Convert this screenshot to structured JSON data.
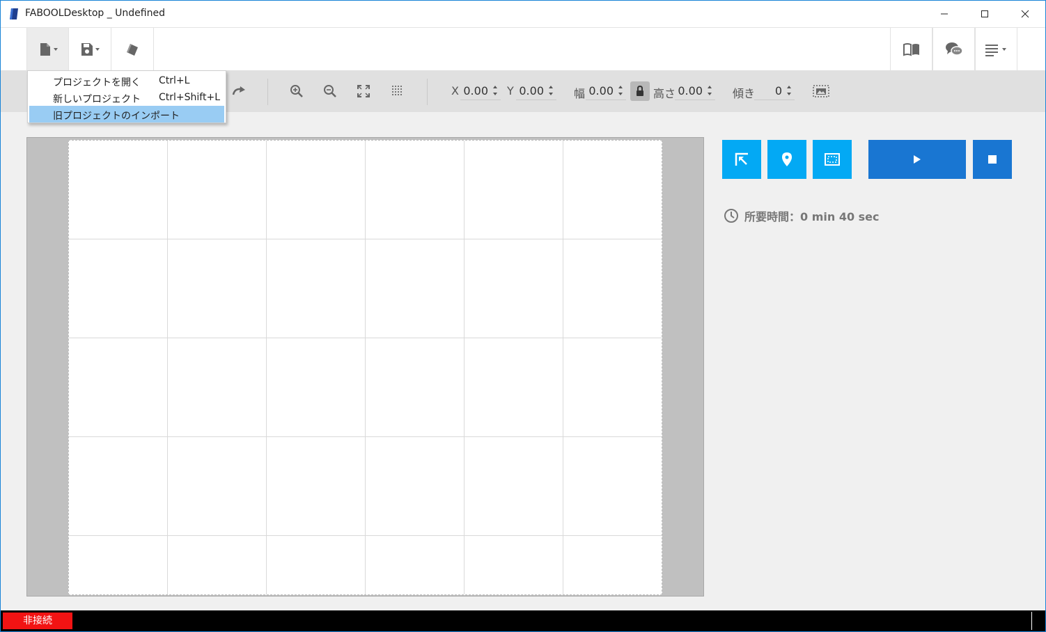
{
  "window": {
    "title": "FABOOLDesktop _ Undefined",
    "controls": [
      "minimize",
      "maximize",
      "close"
    ]
  },
  "toolbar": {
    "left_buttons": [
      {
        "name": "file",
        "icon": "file-icon",
        "has_dropdown": true
      },
      {
        "name": "save",
        "icon": "save-icon",
        "has_dropdown": true
      },
      {
        "name": "eraser",
        "icon": "eraser-icon",
        "has_dropdown": false
      }
    ],
    "right_buttons": [
      {
        "name": "manual",
        "icon": "book-icon"
      },
      {
        "name": "support",
        "icon": "chat-icon"
      },
      {
        "name": "menu",
        "icon": "menu-lines-icon",
        "has_dropdown": true
      }
    ]
  },
  "file_menu": {
    "items": [
      {
        "label": "プロジェクトを開く",
        "shortcut": "Ctrl+L",
        "highlighted": false
      },
      {
        "label": "新しいプロジェクト",
        "shortcut": "Ctrl+Shift+L",
        "highlighted": false
      },
      {
        "label": "旧プロジェクトのインポート",
        "shortcut": "",
        "highlighted": true
      }
    ]
  },
  "subbar": {
    "tools": [
      "redo-icon",
      "zoom-in-icon",
      "zoom-out-icon",
      "fit-screen-icon",
      "grid-icon"
    ],
    "fields": {
      "x": {
        "label": "X",
        "value": "0.00"
      },
      "y": {
        "label": "Y",
        "value": "0.00"
      },
      "width": {
        "label": "幅",
        "value": "0.00"
      },
      "height": {
        "label": "高さ",
        "value": "0.00"
      },
      "tilt": {
        "label": "傾き",
        "value": "0"
      }
    },
    "lock": "lock-icon",
    "image_tool": "image-select-icon"
  },
  "right_panel": {
    "buttons": [
      "home-origin-icon",
      "location-pin-icon",
      "frame-icon",
      "play-icon",
      "stop-icon"
    ],
    "estimated_time": "所要時間：0 min 40 sec"
  },
  "statusbar": {
    "connection": "非接続"
  },
  "colors": {
    "accent_light": "#03a9f4",
    "accent_dark": "#1976d2",
    "menu_highlight": "#99ccf3",
    "disconnected": "#f21313"
  }
}
